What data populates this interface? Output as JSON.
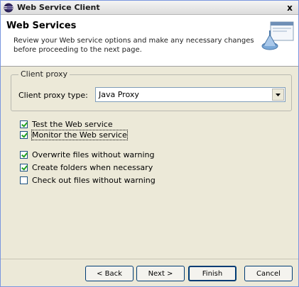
{
  "window": {
    "title": "Web Service Client",
    "close_label": "x"
  },
  "banner": {
    "title": "Web Services",
    "description": "Review your Web service options and make any necessary changes before proceeding to the next page."
  },
  "client_proxy": {
    "group_label": "Client proxy",
    "type_label": "Client proxy type:",
    "selected": "Java Proxy"
  },
  "options": [
    {
      "label": "Test the Web service",
      "checked": true
    },
    {
      "label": "Monitor the Web service",
      "checked": true
    },
    {
      "label": "Overwrite files without warning",
      "checked": true
    },
    {
      "label": "Create folders when necessary",
      "checked": true
    },
    {
      "label": "Check out files without warning",
      "checked": false
    }
  ],
  "buttons": {
    "back": "< Back",
    "next": "Next >",
    "finish": "Finish",
    "cancel": "Cancel"
  }
}
